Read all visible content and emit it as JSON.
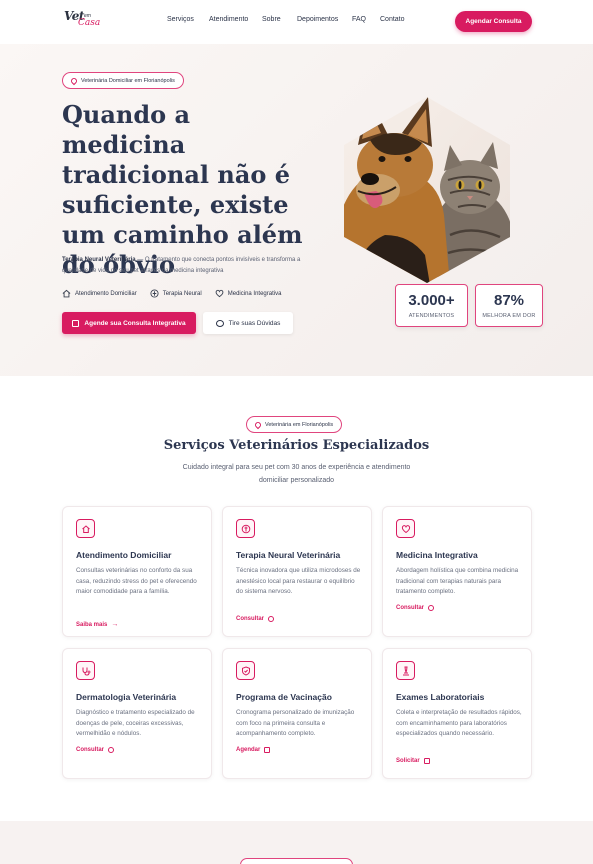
{
  "header": {
    "logo_line1": "Vet",
    "logo_line2": "Casa",
    "logo_small": "em",
    "nav": [
      "Serviços",
      "Atendimento",
      "Sobre",
      "Depoimentos",
      "FAQ",
      "Contato"
    ],
    "cta": "Agendar Consulta"
  },
  "hero": {
    "badge": "Veterinária Domiciliar em Florianópolis",
    "title_lines": [
      "Quando a medicina",
      "tradicional não é",
      "suficiente, existe",
      "um caminho além",
      "do óbvio"
    ],
    "desc_bold": "Terapia Neural Veterinária",
    "desc_rest": " — O tratamento que conecta pontos invisíveis e transforma a qualidade de vida do seu pet através da medicina integrativa",
    "features": [
      "Atendimento Domiciliar",
      "Terapia Neural",
      "Medicina Integrativa"
    ],
    "primary_button": "Agende sua Consulta Integrativa",
    "secondary_button": "Tire suas Dúvidas",
    "stats": [
      {
        "value": "3.000+",
        "label": "ATENDIMENTOS"
      },
      {
        "value": "87%",
        "label": "MELHORA EM DOR"
      }
    ]
  },
  "services": {
    "badge": "Veterinária em Florianópolis",
    "title": "Serviços Veterinários Especializados",
    "subtitle": "Cuidado integral para seu pet com 30 anos de experiência e atendimento domiciliar personalizado",
    "cards": [
      {
        "icon": "home-icon",
        "title": "Atendimento Domiciliar",
        "desc": "Consultas veterinárias no conforto da sua casa, reduzindo stress do pet e oferecendo maior comodidade para a família.",
        "link": "Saiba mais"
      },
      {
        "icon": "needle-icon",
        "title": "Terapia Neural Veterinária",
        "desc": "Técnica inovadora que utiliza microdoses de anestésico local para restaurar o equilíbrio do sistema nervoso.",
        "link": "Consultar"
      },
      {
        "icon": "heart-icon",
        "title": "Medicina Integrativa",
        "desc": "Abordagem holística que combina medicina tradicional com terapias naturais para tratamento completo.",
        "link": "Consultar"
      },
      {
        "icon": "stethoscope-icon",
        "title": "Dermatologia Veterinária",
        "desc": "Diagnóstico e tratamento especializado de doenças de pele, coceiras excessivas, vermelhidão e nódulos.",
        "link": "Consultar"
      },
      {
        "icon": "shield-icon",
        "title": "Programa de Vacinação",
        "desc": "Cronograma personalizado de imunização com foco na primeira consulta e acompanhamento completo.",
        "link": "Agendar"
      },
      {
        "icon": "microscope-icon",
        "title": "Exames Laboratoriais",
        "desc": "Coleta e interpretação de resultados rápidos, com encaminhamento para laboratórios especializados quando necessário.",
        "link": "Solicitar"
      }
    ]
  },
  "colors": {
    "accent": "#d81b60",
    "heading": "#2c3650",
    "hero_bg": "#f6f1ef"
  }
}
